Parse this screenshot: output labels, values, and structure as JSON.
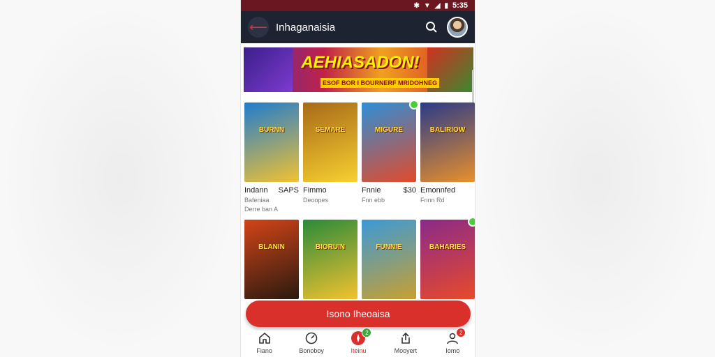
{
  "status_bar": {
    "time": "5:35"
  },
  "app_bar": {
    "title": "Inhaganaisia"
  },
  "banner": {
    "title": "AEHIASADON!",
    "subtitle": "ESOF BOR I BOURNERF MRIDOHNEG"
  },
  "games_row1": [
    {
      "poster_text": "BURNN",
      "title": "Indann",
      "extra": "SAPS",
      "sub1": "Bafeniaa",
      "sub2": "Derre ban A",
      "new": false,
      "colors": [
        "#1f7cd0",
        "#f2c230"
      ]
    },
    {
      "poster_text": "SEMARE",
      "title": "Fimmo",
      "extra": "",
      "sub1": "Deoopes",
      "sub2": "",
      "new": false,
      "colors": [
        "#a86a18",
        "#f7d030"
      ]
    },
    {
      "poster_text": "MIGURE",
      "title": "Fnnie",
      "extra": "$30",
      "sub1": "Fnn ebb",
      "sub2": "",
      "new": true,
      "colors": [
        "#2d8fd8",
        "#e24a2a"
      ]
    },
    {
      "poster_text": "BALIRIOW",
      "title": "Emonnfed",
      "extra": "",
      "sub1": "Fnnn Rd",
      "sub2": "",
      "new": false,
      "colors": [
        "#2a3a8a",
        "#e8902a"
      ]
    }
  ],
  "games_row2": [
    {
      "poster_text": "BLANIN",
      "title": "",
      "new": false,
      "colors": [
        "#d24418",
        "#2a1a10"
      ]
    },
    {
      "poster_text": "BIORUIN",
      "title": "",
      "new": false,
      "colors": [
        "#2a8a3a",
        "#f2c230"
      ]
    },
    {
      "poster_text": "FUNNIE",
      "title": "",
      "new": false,
      "colors": [
        "#3a9ad8",
        "#c8a030"
      ]
    },
    {
      "poster_text": "BAHARIES",
      "title": "",
      "new": true,
      "colors": [
        "#8a2a8a",
        "#e84a2a"
      ]
    }
  ],
  "cta": {
    "label": "Isono Iheoaisa"
  },
  "bottom_nav": [
    {
      "label": "Fiano",
      "icon": "home-icon",
      "badge": "",
      "active": false
    },
    {
      "label": "Bonoboy",
      "icon": "dashboard-icon",
      "badge": "",
      "active": false
    },
    {
      "label": "Iteinu",
      "icon": "games-icon",
      "badge": "2",
      "badge_color": "#3aa83a",
      "active": true
    },
    {
      "label": "Mooyert",
      "icon": "share-icon",
      "badge": "",
      "active": false
    },
    {
      "label": "Iomo",
      "icon": "profile-icon",
      "badge": "2",
      "badge_color": "#d9302c",
      "active": false
    }
  ],
  "colors": {
    "accent": "#d9302c",
    "appbar": "#1e2332",
    "statusbar": "#6b1722"
  }
}
